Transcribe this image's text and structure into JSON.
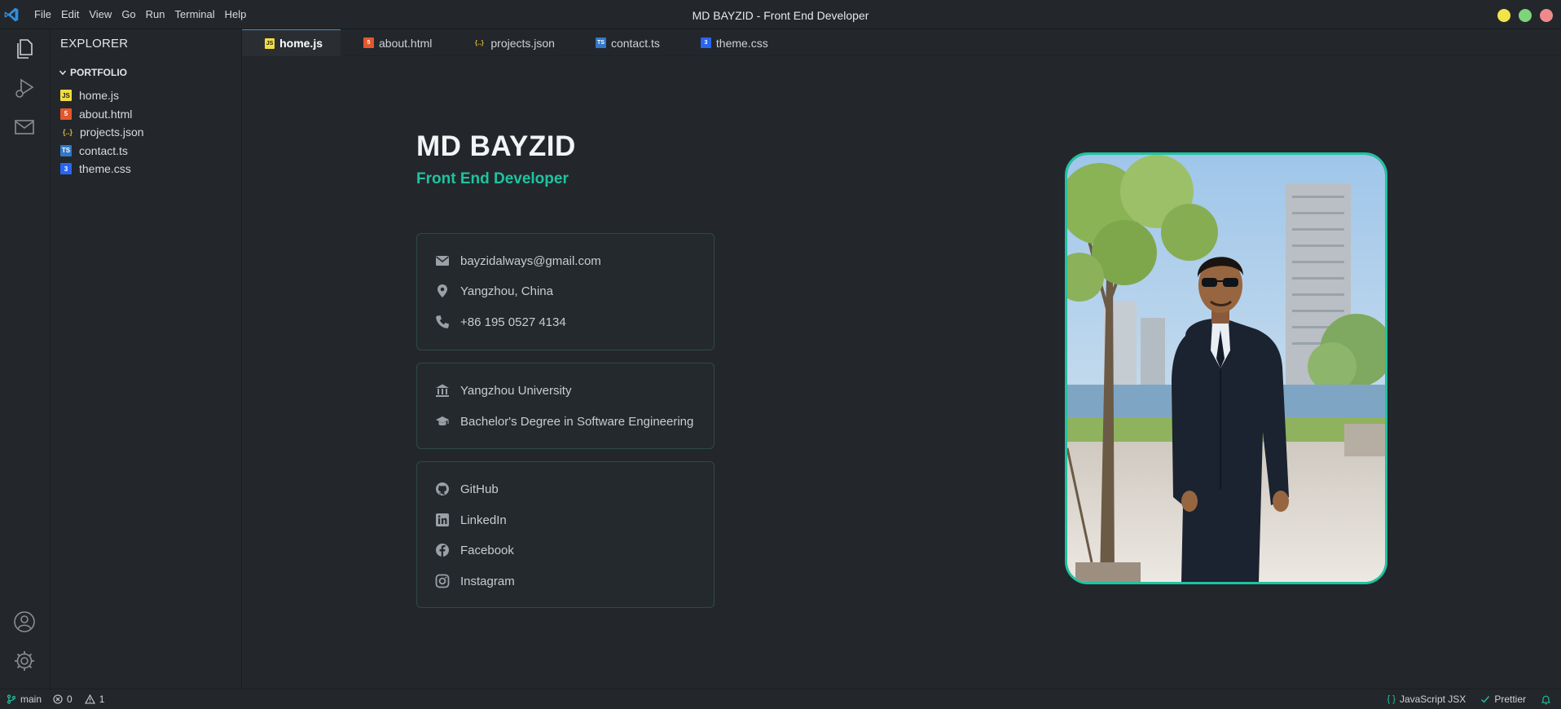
{
  "window": {
    "title": "MD BAYZID - Front End Developer"
  },
  "menu": [
    "File",
    "Edit",
    "View",
    "Go",
    "Run",
    "Terminal",
    "Help"
  ],
  "activity": [
    "files-icon",
    "run-debug-icon",
    "mail-icon",
    "account-icon",
    "settings-icon"
  ],
  "sidebar": {
    "title": "EXPLORER",
    "folder": "PORTFOLIO",
    "files": [
      {
        "name": "home.js",
        "icon": "js-file-icon",
        "badge": "JS",
        "color": "#f1dd3f"
      },
      {
        "name": "about.html",
        "icon": "html-file-icon",
        "badge": "5",
        "color": "#e4572e"
      },
      {
        "name": "projects.json",
        "icon": "json-file-icon",
        "badge": "{..}",
        "color": "#d7b23b"
      },
      {
        "name": "contact.ts",
        "icon": "ts-file-icon",
        "badge": "TS",
        "color": "#3178c6"
      },
      {
        "name": "theme.css",
        "icon": "css-file-icon",
        "badge": "3",
        "color": "#2965f1"
      }
    ]
  },
  "tabs": [
    {
      "name": "home.js",
      "active": true
    },
    {
      "name": "about.html"
    },
    {
      "name": "projects.json"
    },
    {
      "name": "contact.ts"
    },
    {
      "name": "theme.css"
    }
  ],
  "profile": {
    "name": "MD BAYZID",
    "role": "Front End Developer",
    "contact": {
      "email": "bayzidalways@gmail.com",
      "location": "Yangzhou, China",
      "phone": "+86 195 0527 4134"
    },
    "education": {
      "university": "Yangzhou University",
      "degree": "Bachelor's Degree in Software Engineering"
    },
    "social": {
      "github": "GitHub",
      "linkedin": "LinkedIn",
      "facebook": "Facebook",
      "instagram": "Instagram"
    }
  },
  "status": {
    "branch": "main",
    "errors": "0",
    "warnings": "1",
    "language": "JavaScript JSX",
    "formatter": "Prettier"
  },
  "colors": {
    "accent": "#1fc3a0",
    "background": "#23272b",
    "card_border": "#2d4a45"
  }
}
